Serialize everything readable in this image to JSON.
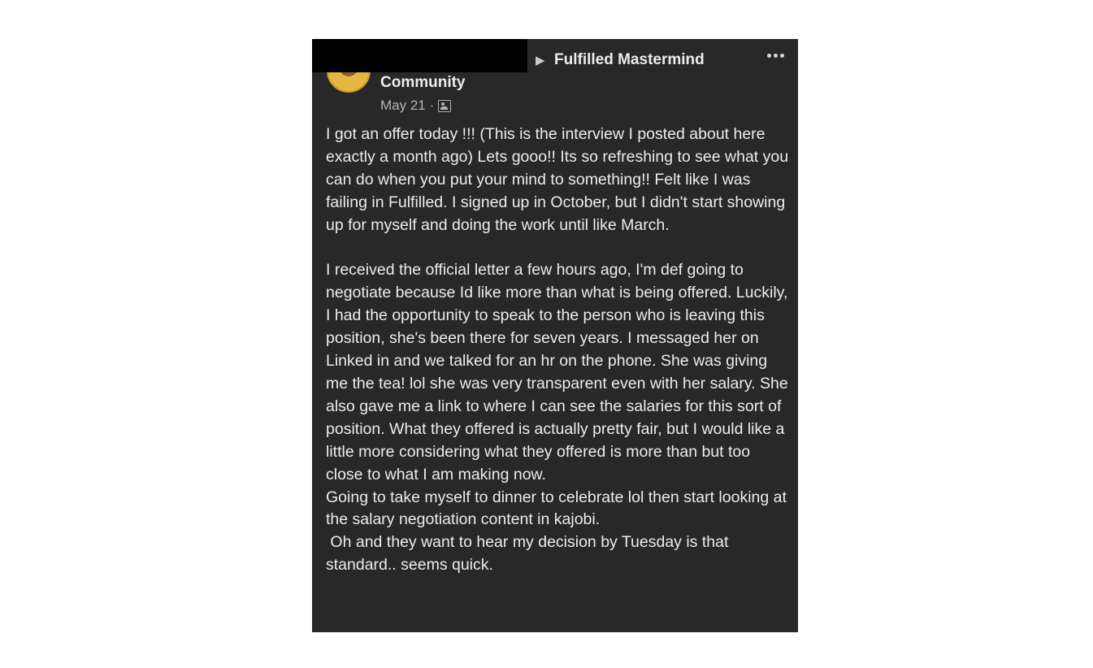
{
  "post": {
    "group_name_line1": "Fulfilled Mastermind",
    "group_name_line2": "Community",
    "breadcrumb_arrow": "▶",
    "date": "May 21",
    "meta_separator": "·",
    "privacy_icon": "members-icon",
    "more_icon": "more-options-icon",
    "body": "I got an offer today !!! (This is the interview I posted about here exactly a month ago) Lets gooo!! Its so refreshing to see what you can do when you put your mind to something!! Felt like I was failing in Fulfilled. I signed up in October, but I didn't start showing up for myself and doing the work until like March.\n\nI received the official letter a few hours ago, I'm def going to negotiate because Id like more than what is being offered. Luckily, I had the opportunity to speak to the person who is leaving this position, she's been there for seven years. I messaged her on Linked in and we talked for an hr on the phone. She was giving me the tea! lol she was very transparent even with her salary. She also gave me a link to where I can see the salaries for this sort of position. What they offered is actually pretty fair, but I would like a little more considering what they offered is more than but too close to what I am making now.\nGoing to take myself to dinner to celebrate lol then start looking at the salary negotiation content in kajobi.\n Oh and they want to hear my decision by Tuesday is that standard.. seems quick."
  },
  "colors": {
    "card_background": "#282828",
    "text_primary": "#ececec",
    "text_secondary": "#b3b3b3",
    "redaction": "#000000"
  }
}
